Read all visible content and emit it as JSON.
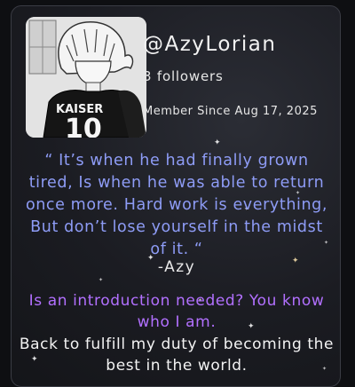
{
  "profile": {
    "username": "@AzyLorian",
    "followers": "3 followers",
    "member_since": "Member Since Aug 17, 2025",
    "avatar": {
      "icon": "anime-avatar-icon",
      "jersey_name": "KAISER",
      "jersey_number": "10"
    }
  },
  "bio": {
    "quote": "“ It’s when he had finally grown tired, Is when he was able to return once more. Hard work is everything, But don’t lose yourself in the midst of it. “",
    "signature": "-Azy",
    "intro": "Is an introduction needed? You know who I am.",
    "motto": "Back to fulfill my duty of becoming the best in the world."
  },
  "colors": {
    "quote": "#8e9cf6",
    "intro": "#b270ff",
    "card_border": "#3a3c44"
  }
}
